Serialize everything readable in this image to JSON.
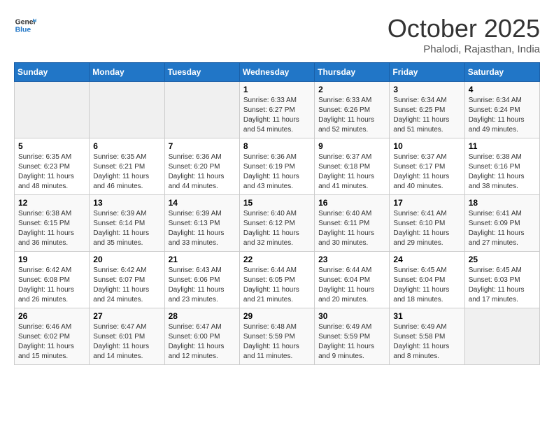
{
  "header": {
    "logo_line1": "General",
    "logo_line2": "Blue",
    "month": "October 2025",
    "location": "Phalodi, Rajasthan, India"
  },
  "weekdays": [
    "Sunday",
    "Monday",
    "Tuesday",
    "Wednesday",
    "Thursday",
    "Friday",
    "Saturday"
  ],
  "weeks": [
    [
      {
        "day": "",
        "info": ""
      },
      {
        "day": "",
        "info": ""
      },
      {
        "day": "",
        "info": ""
      },
      {
        "day": "1",
        "info": "Sunrise: 6:33 AM\nSunset: 6:27 PM\nDaylight: 11 hours\nand 54 minutes."
      },
      {
        "day": "2",
        "info": "Sunrise: 6:33 AM\nSunset: 6:26 PM\nDaylight: 11 hours\nand 52 minutes."
      },
      {
        "day": "3",
        "info": "Sunrise: 6:34 AM\nSunset: 6:25 PM\nDaylight: 11 hours\nand 51 minutes."
      },
      {
        "day": "4",
        "info": "Sunrise: 6:34 AM\nSunset: 6:24 PM\nDaylight: 11 hours\nand 49 minutes."
      }
    ],
    [
      {
        "day": "5",
        "info": "Sunrise: 6:35 AM\nSunset: 6:23 PM\nDaylight: 11 hours\nand 48 minutes."
      },
      {
        "day": "6",
        "info": "Sunrise: 6:35 AM\nSunset: 6:21 PM\nDaylight: 11 hours\nand 46 minutes."
      },
      {
        "day": "7",
        "info": "Sunrise: 6:36 AM\nSunset: 6:20 PM\nDaylight: 11 hours\nand 44 minutes."
      },
      {
        "day": "8",
        "info": "Sunrise: 6:36 AM\nSunset: 6:19 PM\nDaylight: 11 hours\nand 43 minutes."
      },
      {
        "day": "9",
        "info": "Sunrise: 6:37 AM\nSunset: 6:18 PM\nDaylight: 11 hours\nand 41 minutes."
      },
      {
        "day": "10",
        "info": "Sunrise: 6:37 AM\nSunset: 6:17 PM\nDaylight: 11 hours\nand 40 minutes."
      },
      {
        "day": "11",
        "info": "Sunrise: 6:38 AM\nSunset: 6:16 PM\nDaylight: 11 hours\nand 38 minutes."
      }
    ],
    [
      {
        "day": "12",
        "info": "Sunrise: 6:38 AM\nSunset: 6:15 PM\nDaylight: 11 hours\nand 36 minutes."
      },
      {
        "day": "13",
        "info": "Sunrise: 6:39 AM\nSunset: 6:14 PM\nDaylight: 11 hours\nand 35 minutes."
      },
      {
        "day": "14",
        "info": "Sunrise: 6:39 AM\nSunset: 6:13 PM\nDaylight: 11 hours\nand 33 minutes."
      },
      {
        "day": "15",
        "info": "Sunrise: 6:40 AM\nSunset: 6:12 PM\nDaylight: 11 hours\nand 32 minutes."
      },
      {
        "day": "16",
        "info": "Sunrise: 6:40 AM\nSunset: 6:11 PM\nDaylight: 11 hours\nand 30 minutes."
      },
      {
        "day": "17",
        "info": "Sunrise: 6:41 AM\nSunset: 6:10 PM\nDaylight: 11 hours\nand 29 minutes."
      },
      {
        "day": "18",
        "info": "Sunrise: 6:41 AM\nSunset: 6:09 PM\nDaylight: 11 hours\nand 27 minutes."
      }
    ],
    [
      {
        "day": "19",
        "info": "Sunrise: 6:42 AM\nSunset: 6:08 PM\nDaylight: 11 hours\nand 26 minutes."
      },
      {
        "day": "20",
        "info": "Sunrise: 6:42 AM\nSunset: 6:07 PM\nDaylight: 11 hours\nand 24 minutes."
      },
      {
        "day": "21",
        "info": "Sunrise: 6:43 AM\nSunset: 6:06 PM\nDaylight: 11 hours\nand 23 minutes."
      },
      {
        "day": "22",
        "info": "Sunrise: 6:44 AM\nSunset: 6:05 PM\nDaylight: 11 hours\nand 21 minutes."
      },
      {
        "day": "23",
        "info": "Sunrise: 6:44 AM\nSunset: 6:04 PM\nDaylight: 11 hours\nand 20 minutes."
      },
      {
        "day": "24",
        "info": "Sunrise: 6:45 AM\nSunset: 6:04 PM\nDaylight: 11 hours\nand 18 minutes."
      },
      {
        "day": "25",
        "info": "Sunrise: 6:45 AM\nSunset: 6:03 PM\nDaylight: 11 hours\nand 17 minutes."
      }
    ],
    [
      {
        "day": "26",
        "info": "Sunrise: 6:46 AM\nSunset: 6:02 PM\nDaylight: 11 hours\nand 15 minutes."
      },
      {
        "day": "27",
        "info": "Sunrise: 6:47 AM\nSunset: 6:01 PM\nDaylight: 11 hours\nand 14 minutes."
      },
      {
        "day": "28",
        "info": "Sunrise: 6:47 AM\nSunset: 6:00 PM\nDaylight: 11 hours\nand 12 minutes."
      },
      {
        "day": "29",
        "info": "Sunrise: 6:48 AM\nSunset: 5:59 PM\nDaylight: 11 hours\nand 11 minutes."
      },
      {
        "day": "30",
        "info": "Sunrise: 6:49 AM\nSunset: 5:59 PM\nDaylight: 11 hours\nand 9 minutes."
      },
      {
        "day": "31",
        "info": "Sunrise: 6:49 AM\nSunset: 5:58 PM\nDaylight: 11 hours\nand 8 minutes."
      },
      {
        "day": "",
        "info": ""
      }
    ]
  ]
}
